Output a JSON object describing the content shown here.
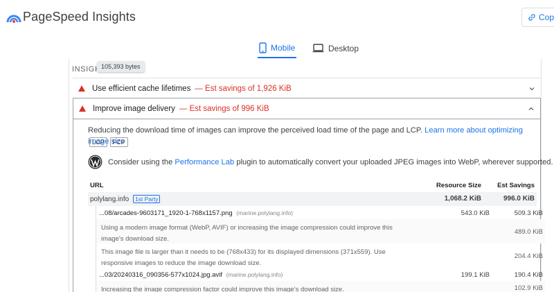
{
  "app": {
    "title": "PageSpeed Insights",
    "copy_label": "Copy"
  },
  "tabs": [
    {
      "label": "Mobile",
      "selected": true
    },
    {
      "label": "Desktop",
      "selected": false
    }
  ],
  "insights": {
    "label": "INSIGHTS",
    "tooltip": "105,393 bytes"
  },
  "audits": [
    {
      "title": "Use efficient cache lifetimes",
      "savings": "— Est savings of 1,926 KiB",
      "expanded": false
    },
    {
      "title": "Improve image delivery",
      "savings": "— Est savings of 996 KiB",
      "expanded": true
    }
  ],
  "details": {
    "description": "Reducing the download time of images can improve the perceived load time of the page and LCP.",
    "learn_more": "Learn more about optimizing image size",
    "tags": [
      "LCP",
      "FCP"
    ],
    "wp_prefix": "Consider using the",
    "wp_link": "Performance Lab",
    "wp_suffix": "plugin to automatically convert your uploaded JPEG images into WebP, wherever supported."
  },
  "table": {
    "headers": {
      "url": "URL",
      "size": "Resource Size",
      "savings": "Est Savings"
    },
    "party": {
      "domain": "polylang.info",
      "badge": "1st Party",
      "size": "1,068.2 KiB",
      "savings": "996.0 KiB"
    },
    "files": [
      {
        "url": "...08/arcades-9603171_1920-1-768x1157.png",
        "host": "(marine.polylang.info)",
        "size": "543.0 KiB",
        "savings": "509.3 KiB",
        "notes": [
          {
            "text": "Using a modern image format (WebP, AVIF) or increasing the image compression could improve this image's download size.",
            "savings": "489.0 KiB"
          },
          {
            "text": "This image file is larger than it needs to be (768x433) for its displayed dimensions (371x559). Use responsive images to reduce the image download size.",
            "savings": "204.4 KiB"
          }
        ]
      },
      {
        "url": "...03/20240316_090356-577x1024.jpg.avif",
        "host": "(marine.polylang.info)",
        "size": "199.1 KiB",
        "savings": "190.4 KiB",
        "notes": [
          {
            "text": "Increasing the image compression factor could improve this image's download size.",
            "savings": "102.9 KiB"
          }
        ]
      }
    ]
  },
  "colors": {
    "accent": "#1a73e8",
    "warning": "#d93025",
    "text": "#202124",
    "muted": "#5f6368"
  }
}
